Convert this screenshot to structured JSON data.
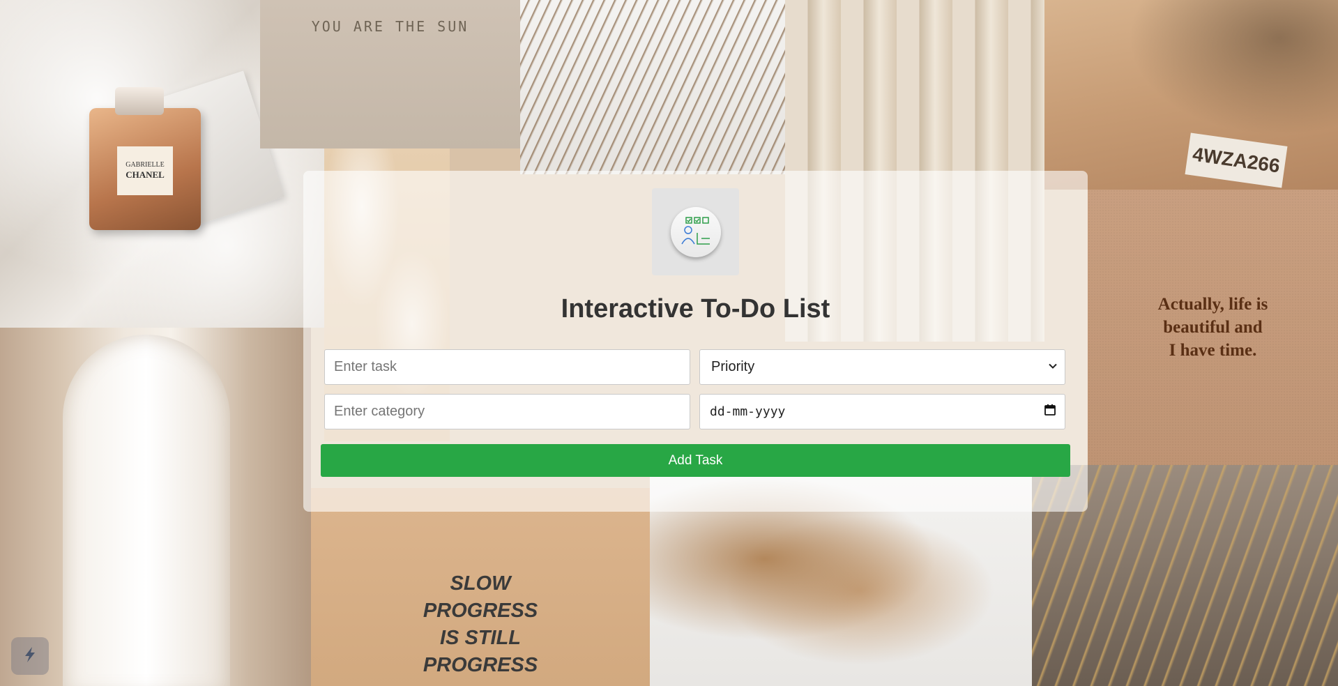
{
  "app": {
    "title": "Interactive To-Do List"
  },
  "form": {
    "task_placeholder": "Enter task",
    "category_placeholder": "Enter category",
    "priority_selected": "Priority",
    "date_placeholder": "dd-mm-yyyy",
    "add_button_label": "Add Task"
  },
  "background": {
    "card_text": "YOU ARE THE SUN",
    "quote_lines": [
      "Actually, life is",
      "beautiful and",
      "I have time."
    ],
    "progress_lines": [
      "SLOW",
      "PROGRESS",
      "IS STILL",
      "PROGRESS"
    ],
    "perfume_label": [
      "GABRIELLE",
      "CHANEL"
    ],
    "plate_text": "4WZA266"
  },
  "icons": {
    "logo": "todo-checklist-person-icon",
    "dropdown": "chevron-down-icon",
    "calendar": "calendar-icon",
    "corner": "lightning-icon"
  },
  "colors": {
    "accent": "#28a745",
    "title": "#333333"
  }
}
